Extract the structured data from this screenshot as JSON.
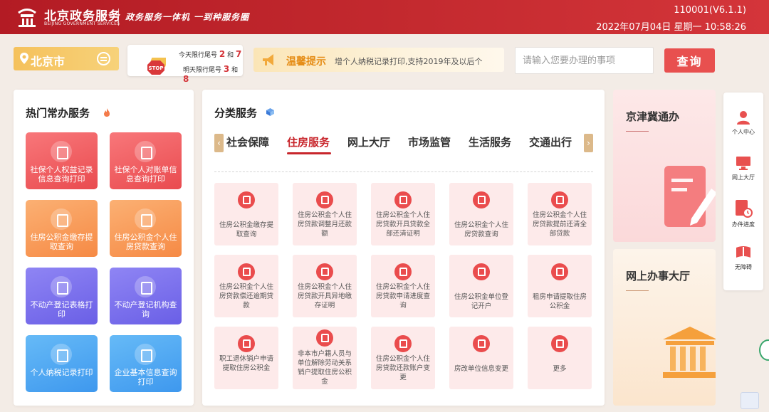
{
  "header": {
    "logo_title": "北京政务服务",
    "logo_sub": "BEIJING GOVERNMENT SERVICES",
    "slogan": "政务服务一体机  一到种服务圈",
    "device_version": "110001(V6.1.1)",
    "datetime": "2022年07月04日 星期一 10:58:26"
  },
  "city": {
    "name": "北京市"
  },
  "traffic_limit": {
    "today_label": "今天限行尾号",
    "today_a": "2",
    "today_and": "和",
    "today_b": "7",
    "tomorrow_label": "明天限行尾号",
    "tomorrow_a": "3",
    "tomorrow_and": "和",
    "tomorrow_b": "8"
  },
  "notice": {
    "title": "温馨提示",
    "text": "增个人纳税记录打印,支持2019年及以后个"
  },
  "search": {
    "placeholder": "请输入您要办理的事项",
    "button": "查询"
  },
  "hot_services": {
    "title": "热门常办服务",
    "tiles": [
      {
        "label": "社保个人权益记录信息查询打印",
        "color": "#ee5e61"
      },
      {
        "label": "社保个人对账单信息查询打印",
        "color": "#ee5e61"
      },
      {
        "label": "住房公积金缴存提取查询",
        "color": "#f89b58"
      },
      {
        "label": "住房公积金个人住房贷款查询",
        "color": "#f89b58"
      },
      {
        "label": "不动产登记表格打印",
        "color": "#7c72ee"
      },
      {
        "label": "不动产登记机构查询",
        "color": "#7c72ee"
      },
      {
        "label": "个人纳税记录打印",
        "color": "#52a9f3"
      },
      {
        "label": "企业基本信息查询打印",
        "color": "#52a9f3"
      }
    ]
  },
  "category": {
    "title": "分类服务",
    "tabs": [
      "社会保障",
      "住房服务",
      "网上大厅",
      "市场监管",
      "生活服务",
      "交通出行"
    ],
    "active_tab": "住房服务",
    "items": [
      {
        "label": "住房公积金缴存提取查询"
      },
      {
        "label": "住房公积金个人住房贷款调整月还款额"
      },
      {
        "label": "住房公积金个人住房贷款开具贷款全部还清证明"
      },
      {
        "label": "住房公积金个人住房贷款查询"
      },
      {
        "label": "住房公积金个人住房贷款提前还清全部贷款"
      },
      {
        "label": "住房公积金个人住房贷款偿还逾期贷款"
      },
      {
        "label": "住房公积金个人住房贷款开具异地缴存证明"
      },
      {
        "label": "住房公积金个人住房贷款申请进度查询"
      },
      {
        "label": "住房公积金单位登记开户"
      },
      {
        "label": "租房申请提取住房公积金"
      },
      {
        "label": "职工退休销户申请提取住房公积金"
      },
      {
        "label": "非本市户籍人员与单位解除劳动关系销户提取住房公积金"
      },
      {
        "label": "住房公积金个人住房贷款还款账户变更"
      },
      {
        "label": "房改单位信息变更"
      },
      {
        "label": "更多"
      }
    ]
  },
  "right_cards": {
    "jjj": "京津冀通办",
    "online_hall": "网上办事大厅"
  },
  "side_nav": [
    {
      "label": "个人中心",
      "icon": "person-icon"
    },
    {
      "label": "网上大厅",
      "icon": "monitor-icon"
    },
    {
      "label": "办件进度",
      "icon": "progress-icon"
    },
    {
      "label": "无障碍",
      "icon": "accessibility-icon"
    }
  ],
  "colors": {
    "brand_red": "#c42a2f",
    "accent_red": "#e8504f",
    "notice_orange": "#e58c15"
  }
}
